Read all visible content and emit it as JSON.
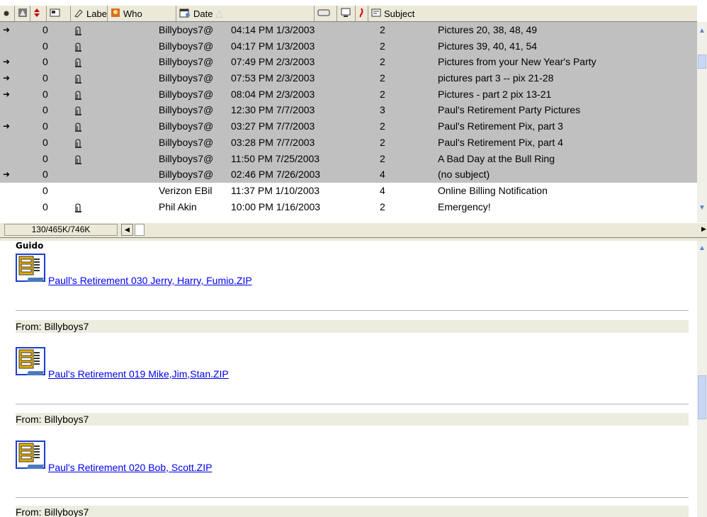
{
  "columns": [
    {
      "key": "status",
      "label": "",
      "icon": "unread-dot-icon"
    },
    {
      "key": "priority",
      "label": "",
      "icon": "priority-icon"
    },
    {
      "key": "sort",
      "label": "",
      "icon": "sort-arrows-icon"
    },
    {
      "key": "attach",
      "label": "",
      "icon": "attachment-column-icon"
    },
    {
      "key": "label",
      "label": "Label",
      "icon": "label-tag-icon"
    },
    {
      "key": "who",
      "label": "Who",
      "icon": "who-icon"
    },
    {
      "key": "date",
      "label": "Date",
      "icon": "calendar-icon"
    },
    {
      "key": "size",
      "label": "",
      "icon": "size-icon"
    },
    {
      "key": "server",
      "label": "",
      "icon": "server-icon"
    },
    {
      "key": "junk",
      "label": "",
      "icon": "junk-icon"
    },
    {
      "key": "subject",
      "label": "Subject",
      "icon": "subject-icon"
    }
  ],
  "messages": [
    {
      "forwarded": true,
      "priority": "0",
      "attachment": true,
      "who": "Billyboys7@",
      "date": "04:14 PM 1/3/2003",
      "size": "2",
      "subject": "Pictures 20, 38, 48, 49",
      "selected": true
    },
    {
      "forwarded": false,
      "priority": "0",
      "attachment": true,
      "who": "Billyboys7@",
      "date": "04:17 PM 1/3/2003",
      "size": "2",
      "subject": "Pictures 39, 40, 41, 54",
      "selected": true
    },
    {
      "forwarded": true,
      "priority": "0",
      "attachment": true,
      "who": "Billyboys7@",
      "date": "07:49 PM 2/3/2003",
      "size": "2",
      "subject": "Pictures from your New Year's Party",
      "selected": true
    },
    {
      "forwarded": true,
      "priority": "0",
      "attachment": true,
      "who": "Billyboys7@",
      "date": "07:53 PM 2/3/2003",
      "size": "2",
      "subject": "pictures part 3 -- pix 21-28",
      "selected": true
    },
    {
      "forwarded": true,
      "priority": "0",
      "attachment": true,
      "who": "Billyboys7@",
      "date": "08:04 PM 2/3/2003",
      "size": "2",
      "subject": "Pictures - part 2 pix 13-21",
      "selected": true
    },
    {
      "forwarded": false,
      "priority": "0",
      "attachment": true,
      "who": "Billyboys7@",
      "date": "12:30 PM 7/7/2003",
      "size": "3",
      "subject": "Paul's Retirement Party Pictures",
      "selected": true
    },
    {
      "forwarded": true,
      "priority": "0",
      "attachment": true,
      "who": "Billyboys7@",
      "date": "03:27 PM 7/7/2003",
      "size": "2",
      "subject": "Paul's Retirement Pix, part 3",
      "selected": true
    },
    {
      "forwarded": false,
      "priority": "0",
      "attachment": true,
      "who": "Billyboys7@",
      "date": "03:28 PM 7/7/2003",
      "size": "2",
      "subject": "Paul's Retirement Pix, part 4",
      "selected": true
    },
    {
      "forwarded": false,
      "priority": "0",
      "attachment": true,
      "who": "Billyboys7@",
      "date": "11:50 PM 7/25/2003",
      "size": "2",
      "subject": "A Bad Day at the Bull Ring",
      "selected": true
    },
    {
      "forwarded": true,
      "priority": "0",
      "attachment": false,
      "who": "Billyboys7@",
      "date": "02:46 PM 7/26/2003",
      "size": "4",
      "subject": "(no subject)",
      "selected": true
    },
    {
      "forwarded": false,
      "priority": "0",
      "attachment": false,
      "who": "Verizon EBil",
      "date": "11:37 PM 1/10/2003",
      "size": "4",
      "subject": "Online Billing Notification",
      "selected": false
    },
    {
      "forwarded": false,
      "priority": "0",
      "attachment": true,
      "who": "Phil Akin",
      "date": "10:00 PM 1/16/2003",
      "size": "2",
      "subject": "Emergency!",
      "selected": false
    }
  ],
  "status": {
    "text": "130/465K/746K"
  },
  "preview": {
    "sender_name": "Guido",
    "attachments": [
      {
        "link": "Paull's Retirement 030 Jerry, Harry, Fumio.ZIP",
        "from": "From: Billyboys7"
      },
      {
        "link": "Paul's Retirement 019 Mike,Jim,Stan.ZIP",
        "from": "From: Billyboys7"
      },
      {
        "link": "Paul's Retirement 020 Bob, Scott.ZIP",
        "from": "From: Billyboys7"
      }
    ]
  },
  "colors": {
    "selected_row": "#c0c0c0",
    "link": "#0000ee",
    "chrome": "#ece9d8"
  }
}
